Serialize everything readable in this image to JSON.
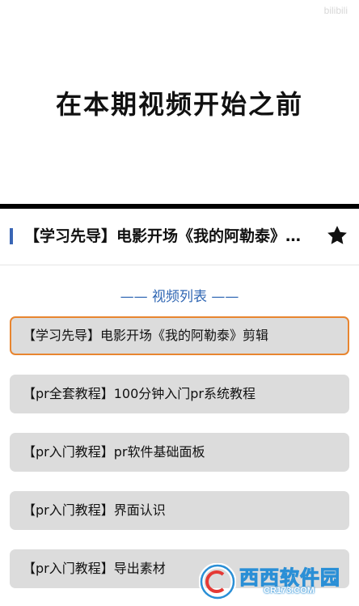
{
  "video": {
    "caption": "在本期视频开始之前",
    "watermark": "bilibili"
  },
  "header": {
    "title": "【学习先导】电影开场《我的阿勒泰》剪辑",
    "favorite_icon": "star-icon"
  },
  "playlist": {
    "heading": "—— 视频列表 ——",
    "items": [
      {
        "label": "【学习先导】电影开场《我的阿勒泰》剪辑",
        "active": true
      },
      {
        "label": "【pr全套教程】100分钟入门pr系统教程",
        "active": false
      },
      {
        "label": "【pr入门教程】pr软件基础面板",
        "active": false
      },
      {
        "label": "【pr入门教程】界面认识",
        "active": false
      },
      {
        "label": "【pr入门教程】导出素材",
        "active": false
      }
    ]
  },
  "watermark_logo": {
    "name": "西西软件园",
    "url": "CR173.COM"
  },
  "colors": {
    "accent_blue": "#2f66b3",
    "active_border": "#e8852f",
    "item_bg": "#dcdcdc"
  }
}
